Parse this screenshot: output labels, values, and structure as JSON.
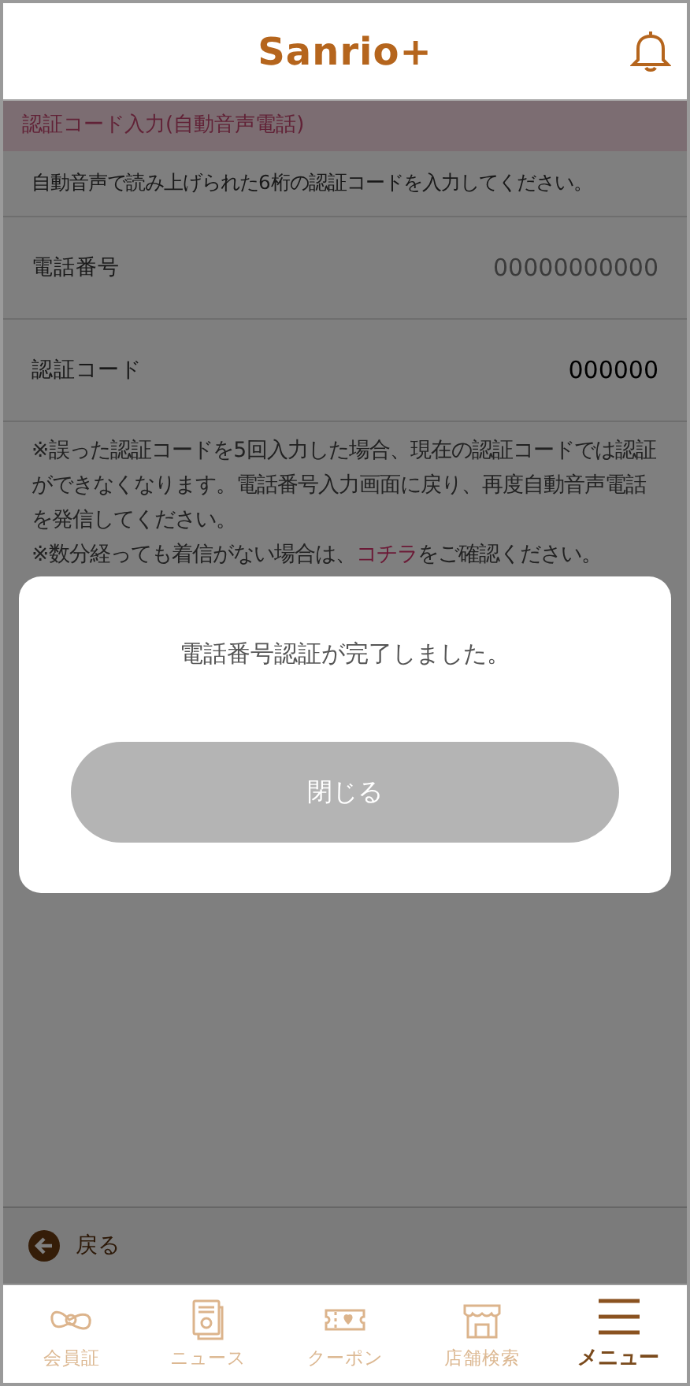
{
  "header": {
    "logo": "Sanrio+"
  },
  "section_title": "認証コード入力(自動音声電話)",
  "instruction": "自動音声で読み上げられた6桁の認証コードを入力してください。",
  "fields": [
    {
      "label": "電話番号",
      "value": "00000000000",
      "kind": "text"
    },
    {
      "label": "認証コード",
      "value": "000000",
      "kind": "input"
    }
  ],
  "notes": [
    {
      "before": "※誤った認証コードを5回入力した場合、現在の認証コードでは認証ができなくなります。電話番号入力画面に戻り、再度自動音声電話を発信してください。"
    },
    {
      "before": "※数分経っても着信がない場合は、",
      "link": "コチラ",
      "after": "をご確認ください。"
    }
  ],
  "back": "戻る",
  "dialog": {
    "message": "電話番号認証が完了しました。",
    "button": "閉じる"
  },
  "tabs": [
    {
      "label": "会員証",
      "selected": false
    },
    {
      "label": "ニュース",
      "selected": false
    },
    {
      "label": "クーポン",
      "selected": false
    },
    {
      "label": "店舗検索",
      "selected": false
    },
    {
      "label": "メニュー",
      "selected": true
    }
  ]
}
